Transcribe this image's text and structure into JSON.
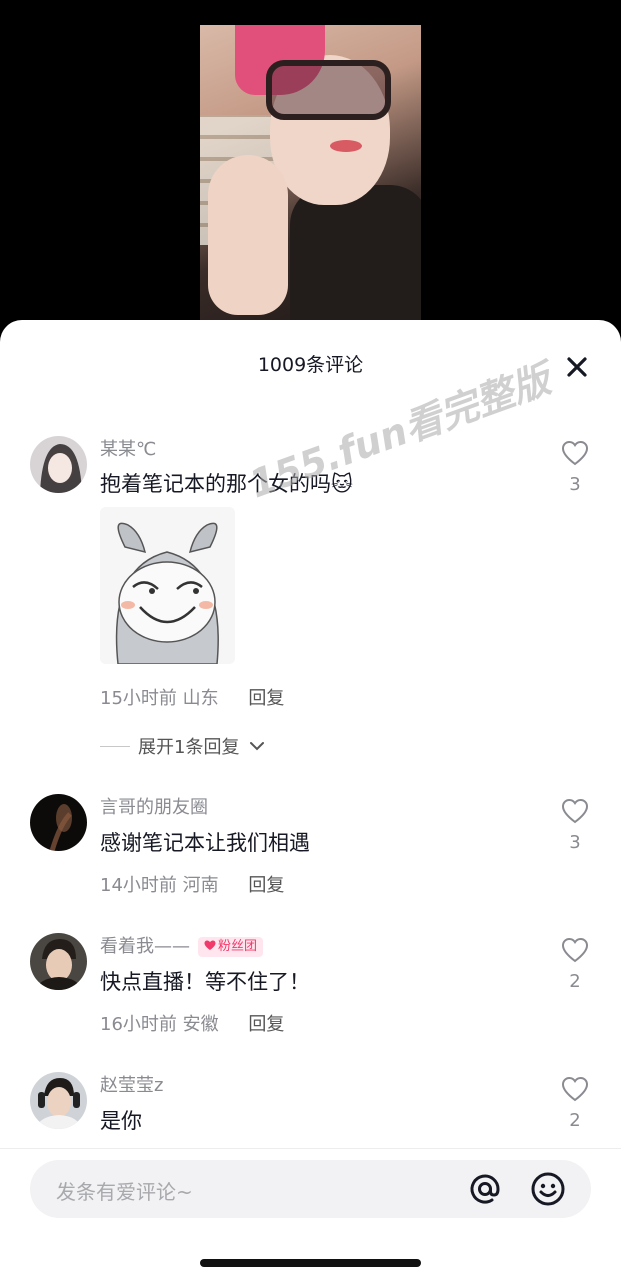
{
  "header": {
    "title": "1009条评论",
    "close_icon": "close-icon"
  },
  "watermark": "155.fun看完整版",
  "comments": [
    {
      "username": "某某℃",
      "text": "抱着笔记本的那个女的吗🐱",
      "time": "15小时前",
      "location": "山东",
      "reply_label": "回复",
      "likes": "3",
      "sticker": "bunny-sticker",
      "expand_label": "展开1条回复"
    },
    {
      "username": "言哥的朋友圈",
      "text": "感谢笔记本让我们相遇",
      "time": "14小时前",
      "location": "河南",
      "reply_label": "回复",
      "likes": "3"
    },
    {
      "username": "看着我——",
      "badge": "粉丝团",
      "text": "快点直播！等不住了！",
      "time": "16小时前",
      "location": "安徽",
      "reply_label": "回复",
      "likes": "2"
    },
    {
      "username": "赵莹莹z",
      "text": "是你",
      "likes": "2"
    }
  ],
  "input": {
    "placeholder": "发条有爱评论~",
    "at_icon": "at-icon",
    "emoji_icon": "emoji-icon"
  },
  "colors": {
    "text": "#161823",
    "secondary": "#8a8b91",
    "badge": "#f03a6b"
  }
}
